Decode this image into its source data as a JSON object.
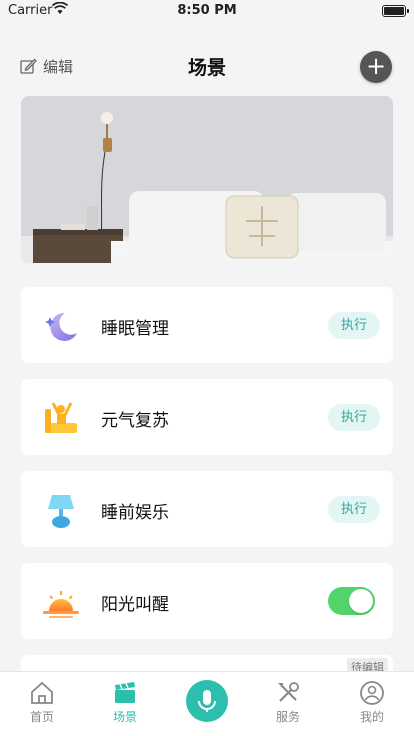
{
  "status_bar": {
    "carrier": "Carrier",
    "time": "8:50 PM"
  },
  "header": {
    "edit_label": "编辑",
    "title": "场景"
  },
  "scenes": [
    {
      "name": "睡眠管理",
      "action": "执行",
      "icon": "moon-star-icon"
    },
    {
      "name": "元气复苏",
      "action": "执行",
      "icon": "stretch-icon"
    },
    {
      "name": "睡前娱乐",
      "action": "执行",
      "icon": "lamp-icon"
    },
    {
      "name": "阳光叫醒",
      "action": "toggle",
      "toggle_on": true,
      "icon": "sunrise-icon"
    }
  ],
  "pending_badge": "待编辑",
  "tabbar": {
    "tabs": [
      {
        "label": "首页",
        "icon": "home-icon"
      },
      {
        "label": "场景",
        "icon": "clapperboard-icon",
        "active": true
      },
      {
        "label": "",
        "icon": "microphone-icon"
      },
      {
        "label": "服务",
        "icon": "tools-icon"
      },
      {
        "label": "我的",
        "icon": "user-icon"
      }
    ]
  },
  "colors": {
    "accent": "#2dbfae",
    "toggle_on": "#53d46b",
    "exec_bg": "#e3f6f4"
  }
}
